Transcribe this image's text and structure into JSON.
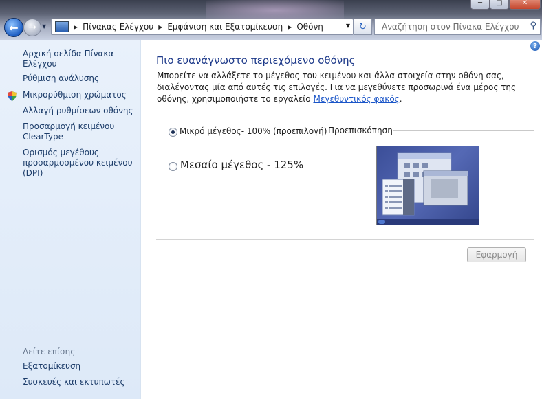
{
  "window": {
    "minimize_icon": "minimize-icon",
    "maximize_icon": "maximize-icon",
    "close_icon": "close-icon"
  },
  "nav": {
    "breadcrumb": [
      "Πίνακας Ελέγχου",
      "Εμφάνιση και Εξατομίκευση",
      "Οθόνη"
    ],
    "search_placeholder": "Αναζήτηση στον Πίνακα Ελέγχου"
  },
  "sidebar": {
    "home": "Αρχική σελίδα Πίνακα Ελέγχου",
    "items": [
      "Ρύθμιση ανάλυσης",
      "Μικρορύθμιση χρώματος",
      "Αλλαγή ρυθμίσεων οθόνης",
      "Προσαρμογή κειμένου ClearType",
      "Ορισμός μεγέθους προσαρμοσμένου κειμένου (DPI)"
    ],
    "see_also_title": "Δείτε επίσης",
    "see_also": [
      "Εξατομίκευση",
      "Συσκευές και εκτυπωτές"
    ]
  },
  "main": {
    "title": "Πιο ευανάγνωστο περιεχόμενο οθόνης",
    "description_pre": "Μπορείτε να αλλάξετε το μέγεθος του κειμένου και άλλα στοιχεία στην οθόνη σας, διαλέγοντας μία από αυτές τις επιλογές. Για να μεγεθύνετε προσωρινά ένα μέρος της οθόνης, χρησιμοποιήστε το εργαλείο ",
    "description_link": "Μεγεθυντικός φακός",
    "description_post": ".",
    "options": [
      "Μικρό μέγεθος- 100% (προεπιλογή)",
      "Μεσαίο μέγεθος - 125%"
    ],
    "selected_option": 0,
    "preview_label": "Προεπισκόπηση",
    "apply_label": "Εφαρμογή"
  },
  "colors": {
    "accent_title": "#1e3a8a",
    "link": "#1a55c8",
    "sidebar_bg": "#e4eef9"
  }
}
